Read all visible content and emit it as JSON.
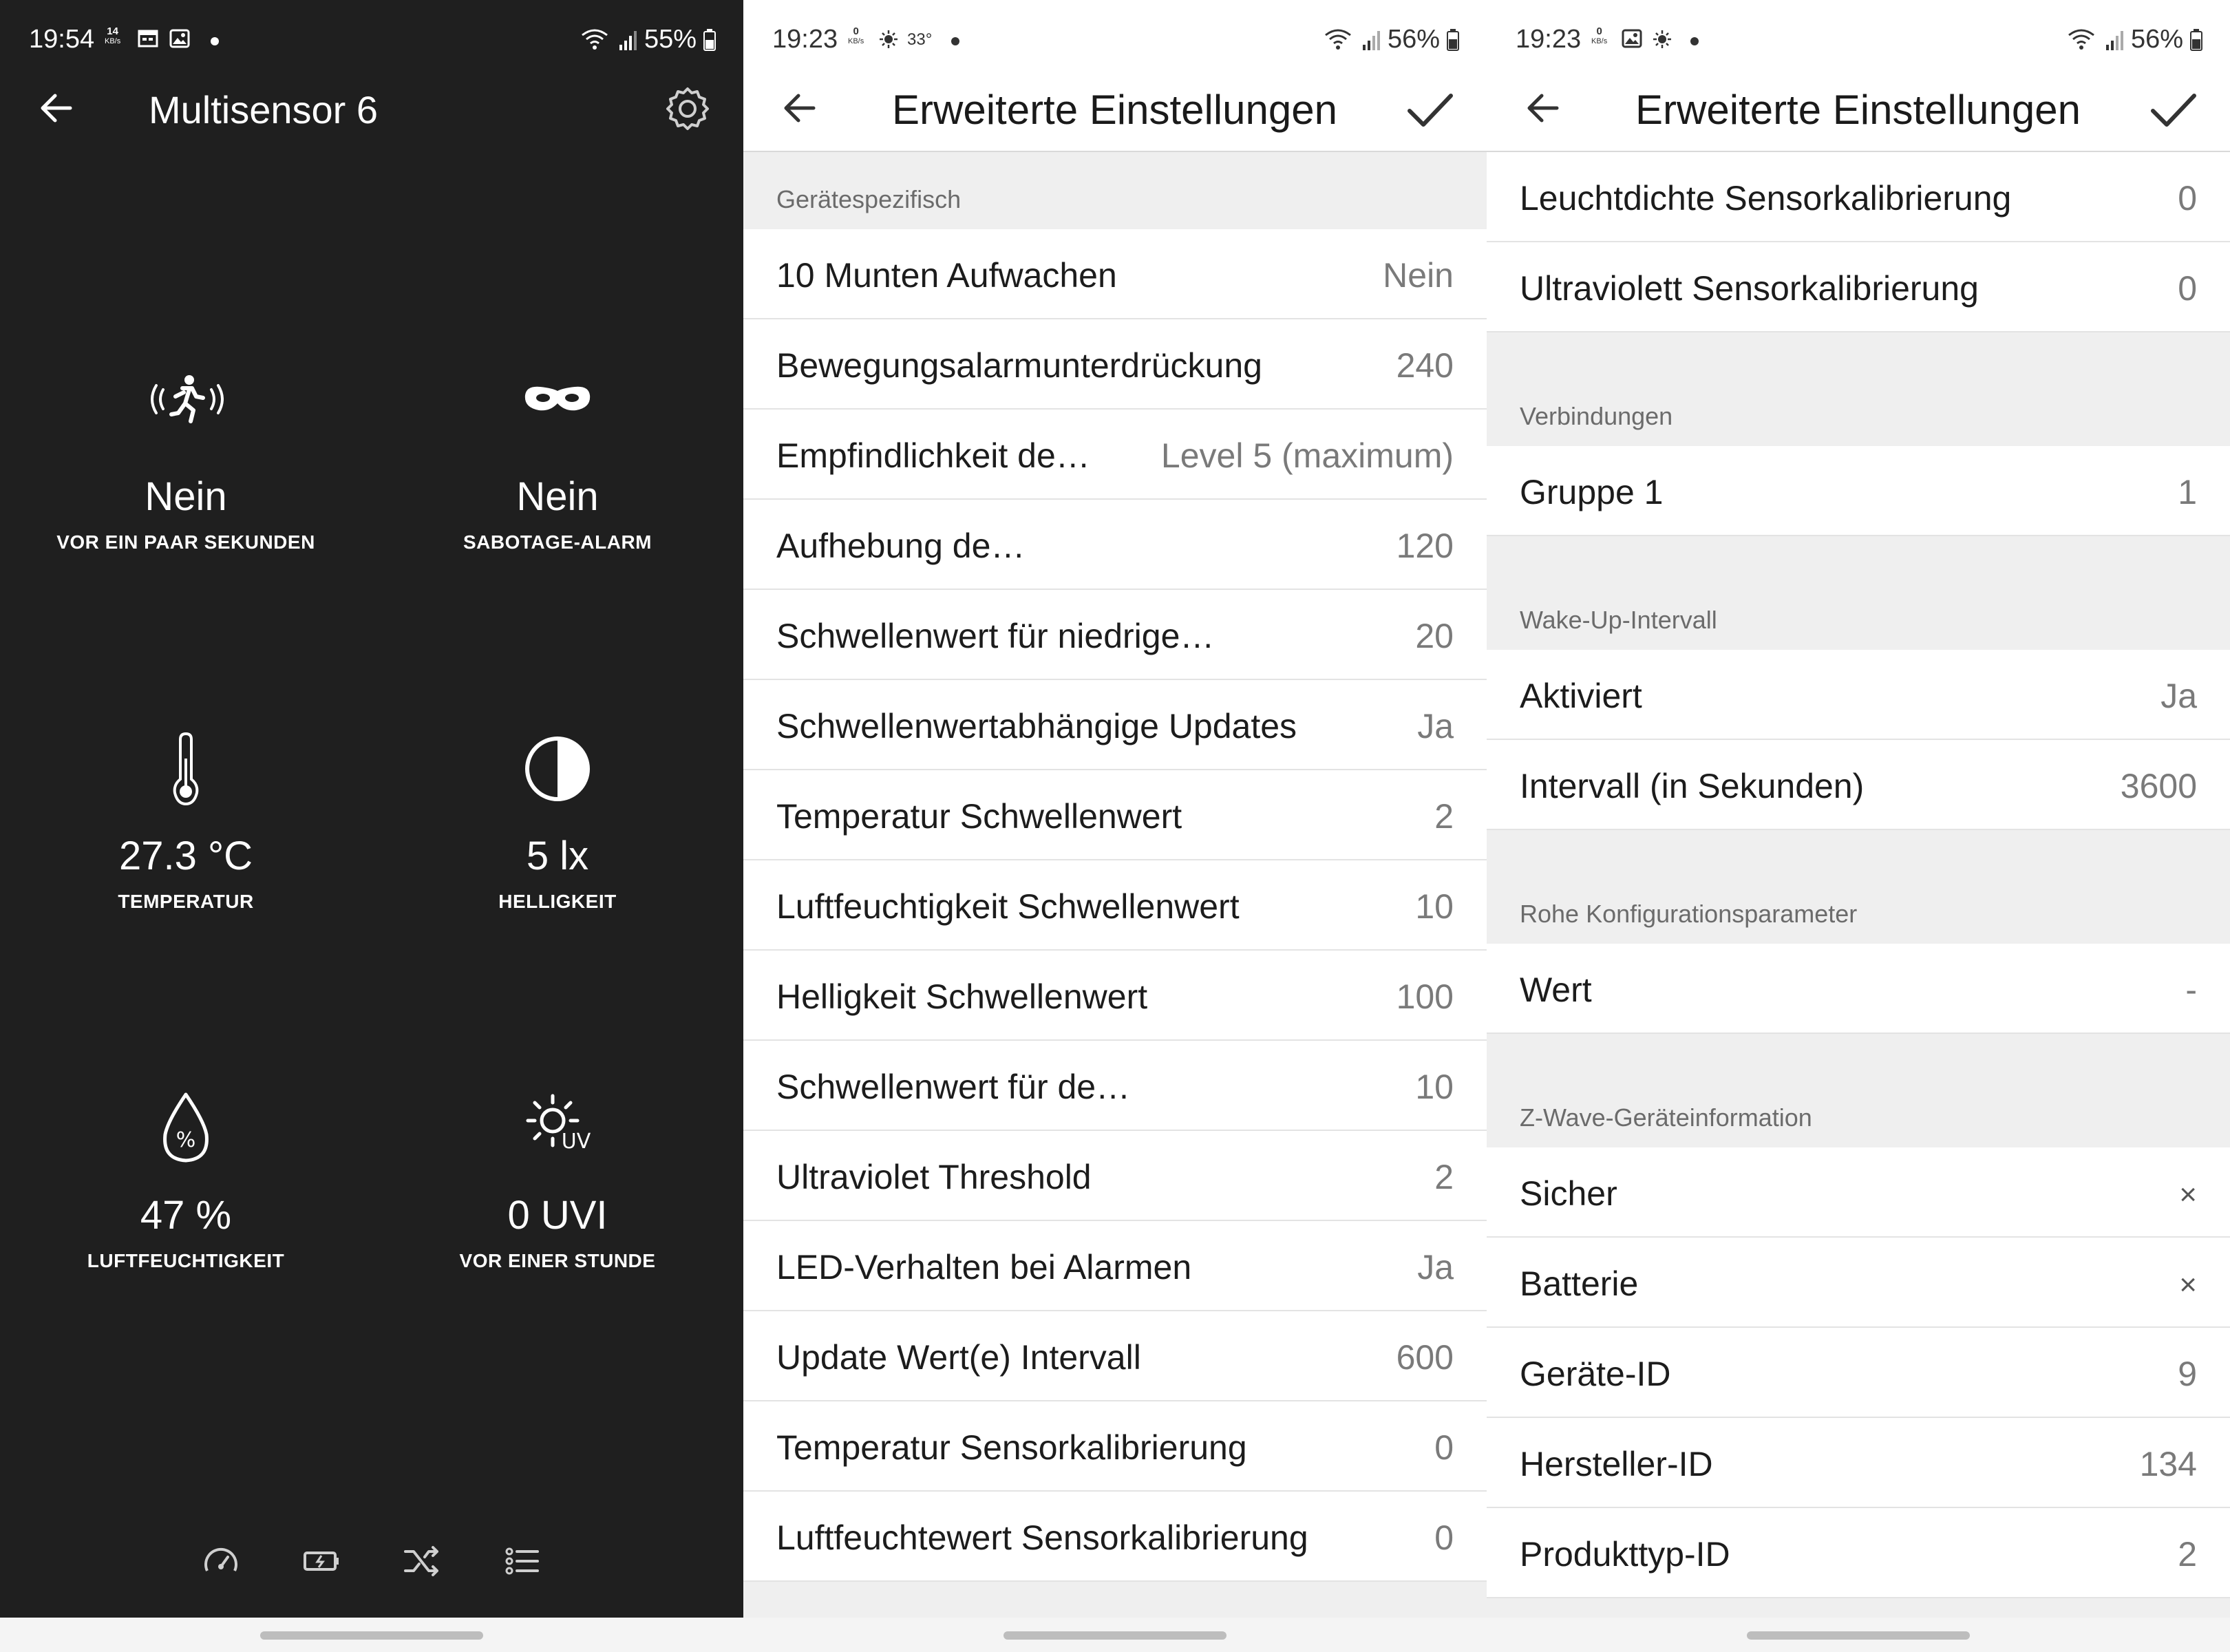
{
  "screen1": {
    "status": {
      "time": "19:54",
      "net_value": "14",
      "net_unit": "KB/s",
      "battery": "55%"
    },
    "title": "Multisensor 6",
    "tiles": [
      {
        "icon": "motion-icon",
        "value": "Nein",
        "label": "VOR EIN PAAR SEKUNDEN"
      },
      {
        "icon": "mask-icon",
        "value": "Nein",
        "label": "SABOTAGE-ALARM"
      },
      {
        "icon": "thermometer-icon",
        "value": "27.3 °C",
        "label": "TEMPERATUR"
      },
      {
        "icon": "brightness-icon",
        "value": "5 lx",
        "label": "HELLIGKEIT"
      },
      {
        "icon": "humidity-icon",
        "value": "47 %",
        "label": "LUFTFEUCHTIGKEIT"
      },
      {
        "icon": "uv-icon",
        "value": "0 UVI",
        "label": "VOR EINER STUNDE"
      }
    ],
    "bottom_tabs": [
      "gauge-icon",
      "battery-icon",
      "shuffle-icon",
      "list-icon"
    ]
  },
  "screen2": {
    "status": {
      "time": "19:23",
      "net_value": "0",
      "net_unit": "KB/s",
      "temp": "33°",
      "battery": "56%"
    },
    "title": "Erweiterte Einstellungen",
    "section": "Gerätespezifisch",
    "rows": [
      {
        "key": "10 Munten Aufwachen",
        "value": "Nein"
      },
      {
        "key": "Bewegungsalarmunterdrückung",
        "value": "240"
      },
      {
        "key": "Empfindlichkeit de…",
        "value": "Level 5 (maximum)"
      },
      {
        "key": "Aufhebung de…",
        "value": "120"
      },
      {
        "key": "Schwellenwert für niedrige…",
        "value": "20"
      },
      {
        "key": "Schwellenwertabhängige Updates",
        "value": "Ja"
      },
      {
        "key": "Temperatur Schwellenwert",
        "value": "2"
      },
      {
        "key": "Luftfeuchtigkeit Schwellenwert",
        "value": "10"
      },
      {
        "key": "Helligkeit Schwellenwert",
        "value": "100"
      },
      {
        "key": "Schwellenwert für de…",
        "value": "10"
      },
      {
        "key": "Ultraviolet Threshold",
        "value": "2"
      },
      {
        "key": "LED-Verhalten bei Alarmen",
        "value": "Ja"
      },
      {
        "key": "Update Wert(e) Intervall",
        "value": "600"
      },
      {
        "key": "Temperatur Sensorkalibrierung",
        "value": "0"
      },
      {
        "key": "Luftfeuchtewert Sensorkalibrierung",
        "value": "0"
      }
    ]
  },
  "screen3": {
    "status": {
      "time": "19:23",
      "net_value": "0",
      "net_unit": "KB/s",
      "battery": "56%"
    },
    "title": "Erweiterte Einstellungen",
    "top_rows": [
      {
        "key": "Leuchtdichte Sensorkalibrierung",
        "value": "0"
      },
      {
        "key": "Ultraviolett Sensorkalibrierung",
        "value": "0"
      }
    ],
    "section_connections": "Verbindungen",
    "connections": [
      {
        "key": "Gruppe 1",
        "value": "1"
      }
    ],
    "section_wakeup": "Wake-Up-Intervall",
    "wakeup": [
      {
        "key": "Aktiviert",
        "value": "Ja"
      },
      {
        "key": "Intervall (in Sekunden)",
        "value": "3600"
      }
    ],
    "section_raw": "Rohe Konfigurationsparameter",
    "raw": [
      {
        "key": "Wert",
        "value": "-"
      }
    ],
    "section_zwave": "Z-Wave-Geräteinformation",
    "zwave": [
      {
        "key": "Sicher",
        "value": "×"
      },
      {
        "key": "Batterie",
        "value": "×"
      },
      {
        "key": "Geräte-ID",
        "value": "9"
      },
      {
        "key": "Hersteller-ID",
        "value": "134"
      },
      {
        "key": "Produkttyp-ID",
        "value": "2"
      }
    ]
  }
}
